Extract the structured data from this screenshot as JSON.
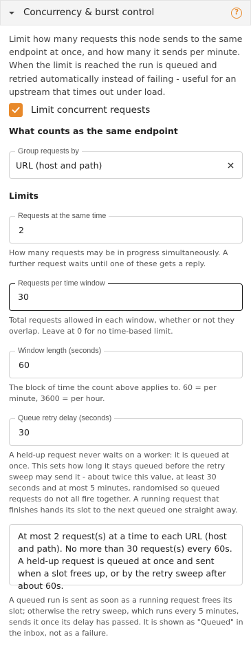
{
  "panel": {
    "title": "Concurrency & burst control",
    "help_icon": "question-circle-icon"
  },
  "description": "Limit how many requests this node sends to the same endpoint at once, and how many it sends per minute. When the limit is reached the run is queued and retried automatically instead of failing - useful for an upstream that times out under load.",
  "limit_concurrent": {
    "checked": true,
    "label": "Limit concurrent requests"
  },
  "endpoint_section": {
    "heading": "What counts as the same endpoint",
    "group_by": {
      "label": "Group requests by",
      "value": "URL (host and path)"
    }
  },
  "limits_section": {
    "heading": "Limits",
    "same_time": {
      "label": "Requests at the same time",
      "value": "2",
      "help": "How many requests may be in progress simultaneously. A further request waits until one of these gets a reply."
    },
    "per_window": {
      "label": "Requests per time window",
      "value": "30",
      "help": "Total requests allowed in each window, whether or not they overlap. Leave at 0 for no time-based limit."
    },
    "window_length": {
      "label": "Window length (seconds)",
      "value": "60",
      "help": "The block of time the count above applies to. 60 = per minute, 3600 = per hour."
    },
    "retry_delay": {
      "label": "Queue retry delay (seconds)",
      "value": "30",
      "help": "A held-up request never waits on a worker: it is queued at once. This sets how long it stays queued before the retry sweep may send it - about twice this value, at least 30 seconds and at most 5 minutes, randomised so queued requests do not all fire together. A running request that finishes hands its slot to the next queued one straight away."
    }
  },
  "summary": "At most 2 request(s) at a time to each URL (host and path). No more than 30 request(s) every 60s. A held-up request is queued at once and sent when a slot frees up, or by the retry sweep after about 60s.",
  "footer_note": "A queued run is sent as soon as a running request frees its slot; otherwise the retry sweep, which runs every 5 minutes, sends it once its delay has passed. It is shown as \"Queued\" in the inbox, not as a failure.",
  "colors": {
    "accent": "#e8892a",
    "focus_border": "#1a1a1a",
    "header_bg": "#f4f4f4"
  }
}
